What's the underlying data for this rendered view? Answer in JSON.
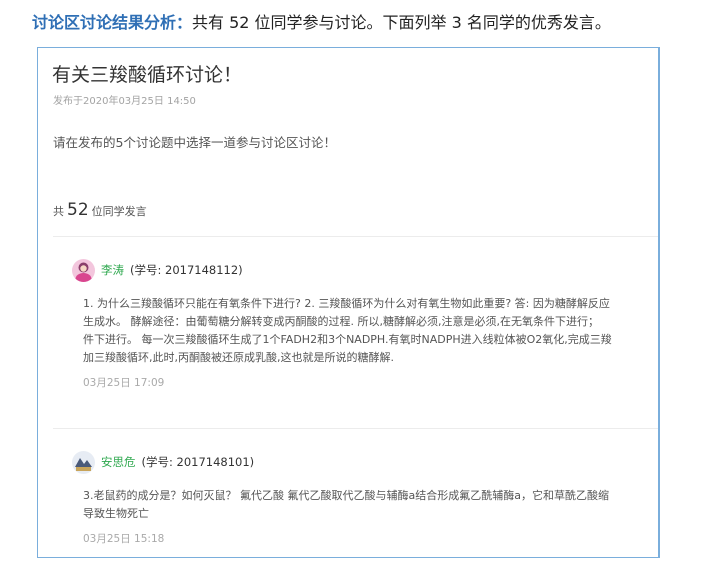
{
  "headline": {
    "lead": "讨论区讨论结果分析：",
    "prefix": "共有 52 位同学参与讨论。下面列举 3 名同学的优秀发言。"
  },
  "topic": {
    "title": "有关三羧酸循环讨论！",
    "published": "发布于2020年03月25日 14:50",
    "description": "请在发布的5个讨论题中选择一道参与讨论区讨论！"
  },
  "stats": {
    "prefix": "共",
    "count": "52",
    "suffix": "位同学发言"
  },
  "posts": [
    {
      "author": "李涛",
      "student_id": "(学号: 2017148112)",
      "lines": [
        "1. 为什么三羧酸循环只能在有氧条件下进行? 2. 三羧酸循环为什么对有氧生物如此重要? 答: 因为糖酵解反应",
        "生成水。 酵解途径：由葡萄糖分解转变成丙酮酸的过程. 所以,糖酵解必须,注意是必须,在无氧条件下进行；",
        "件下进行。 每一次三羧酸循环生成了1个FADH2和3个NADPH.有氧时NADPH进入线粒体被O2氧化,完成三羧",
        "加三羧酸循环,此时,丙酮酸被还原成乳酸,这也就是所说的糖酵解."
      ],
      "time": "03月25日 17:09"
    },
    {
      "author": "安思危",
      "student_id": "(学号: 2017148101)",
      "lines": [
        "3.老鼠药的成分是？如何灭鼠？ 氟代乙酸 氟代乙酸取代乙酸与辅酶a结合形成氟乙酰辅酶a，它和草酰乙酸缩",
        "导致生物死亡"
      ],
      "time": "03月25日 15:18"
    }
  ],
  "colors": {
    "accent_blue": "#2f6fb5",
    "panel_border": "#7aaedc",
    "author_green": "#2fa84f"
  }
}
